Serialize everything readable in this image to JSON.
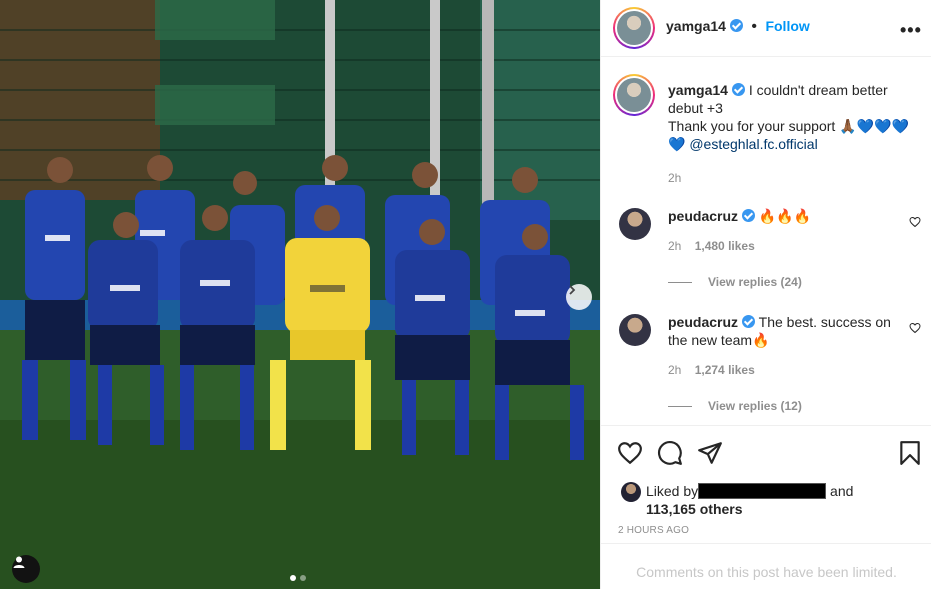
{
  "post": {
    "author": "yamga14",
    "follow_label": "Follow",
    "more_label": "•••",
    "caption": {
      "line1": "I couldn't dream better",
      "line2": "debut +3",
      "line3": "Thank you for your support 🙏🏾💙💙💙",
      "line4_emoji": "💙",
      "mention": "@esteghlal.fc.official",
      "time": "2h"
    },
    "carousel": {
      "current": 1,
      "total": 2
    }
  },
  "comments": [
    {
      "user": "peudacruz",
      "text": "🔥🔥🔥",
      "time": "2h",
      "likes": "1,480 likes",
      "replies": "View replies (24)"
    },
    {
      "user": "peudacruz",
      "text_line1": "The best. success on",
      "text_line2": "the new team🔥",
      "time": "2h",
      "likes": "1,274 likes",
      "replies": "View replies (12)"
    }
  ],
  "likes": {
    "prefix": "Liked by",
    "suffix": "and",
    "count": "113,165 others"
  },
  "timestamp": "2 HOURS AGO",
  "comments_limited": "Comments on this post have been limited.",
  "icons": [
    "heart-icon",
    "comment-icon",
    "share-icon",
    "bookmark-icon",
    "user-tag-icon",
    "chevron-right-icon",
    "more-icon"
  ],
  "colors": {
    "accent": "#0095f6",
    "verified": "#3897f0",
    "mention": "#00376b",
    "jersey": "#1f3fa8",
    "keeper": "#f2d33a"
  }
}
